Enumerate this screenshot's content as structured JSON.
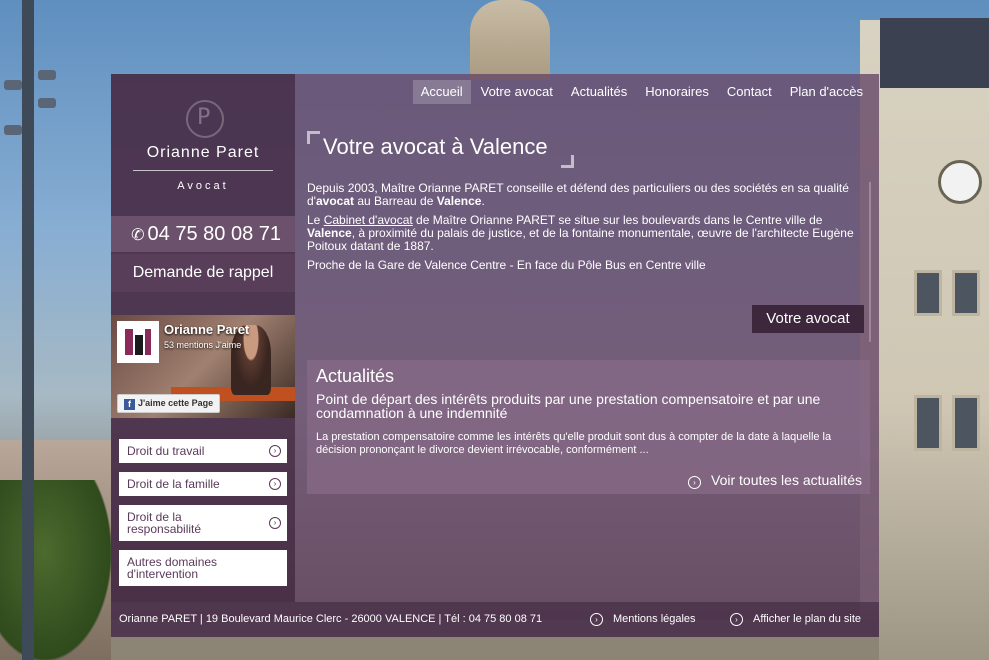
{
  "brand": {
    "logo_letter": "P",
    "name": "Orianne Paret",
    "role": "Avocat"
  },
  "contact": {
    "phone": "04 75 80 08 71",
    "callback_label": "Demande de rappel"
  },
  "facebook": {
    "page_name": "Orianne Paret",
    "likes": "53 mentions J'aime",
    "like_button": "J'aime cette Page"
  },
  "practice_areas": [
    {
      "label": "Droit du travail"
    },
    {
      "label": "Droit de la famille"
    },
    {
      "label": "Droit de la responsabilité"
    },
    {
      "label": "Autres domaines d'intervention"
    }
  ],
  "nav": {
    "items": [
      {
        "label": "Accueil",
        "active": true
      },
      {
        "label": "Votre avocat"
      },
      {
        "label": "Actualités"
      },
      {
        "label": "Honoraires"
      },
      {
        "label": "Contact"
      },
      {
        "label": "Plan d'accès"
      }
    ]
  },
  "main": {
    "title": "Votre avocat à Valence",
    "p1_a": "Depuis 2003, Maître Orianne PARET conseille et défend des particuliers ou des sociétés en sa qualité d'",
    "p1_b": "avocat",
    "p1_c": " au Barreau de ",
    "p1_d": "Valence",
    "p1_e": ".",
    "p2_a": "Le ",
    "p2_link": "Cabinet d'avocat",
    "p2_b": " de Maître Orianne PARET se situe sur les boulevards dans le Centre ville de ",
    "p2_c": "Valence",
    "p2_d": ", à proximité du palais de justice, et de la fontaine monumentale, œuvre de l'architecte Eugène Poitoux datant de 1887.",
    "p3": "Proche de la Gare de Valence Centre - En face du Pôle Bus en Centre ville",
    "cta": "Votre avocat"
  },
  "news": {
    "heading": "Actualités",
    "title": "Point de départ des intérêts produits par une prestation compensatoire et par une condamnation à une indemnité",
    "excerpt": "La prestation compensatoire comme les intérêts qu'elle produit sont dus à compter de la date à laquelle la décision prononçant le divorce devient irrévocable, conformément ...",
    "all_link": "Voir toutes les actualités"
  },
  "footer": {
    "address": "Orianne PARET | 19 Boulevard Maurice Clerc - 26000 VALENCE | Tél : 04 75 80 08 71",
    "legal": "Mentions légales",
    "sitemap": "Afficher le plan du site"
  }
}
